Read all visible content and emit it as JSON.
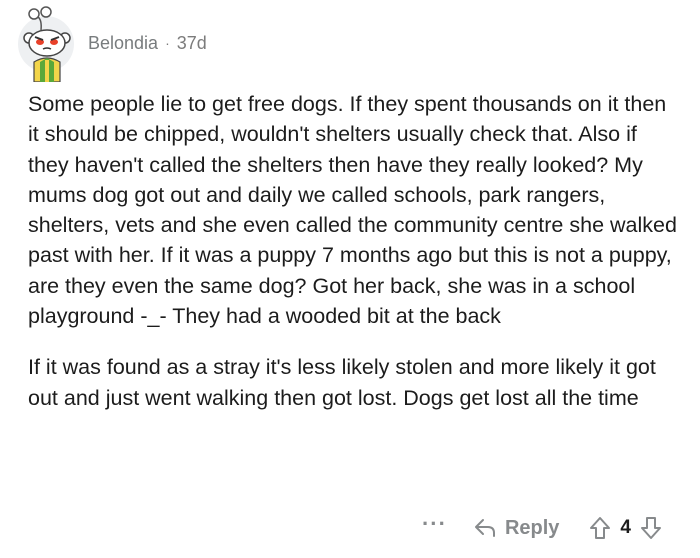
{
  "comment": {
    "author": "Belondia",
    "separator": "·",
    "age": "37d",
    "paragraphs": [
      "Some people lie to get free dogs. If they spent thousands on it then it should be chipped, wouldn't shelters usually check that. Also if they haven't called the shelters then have they really looked? My mums dog got out and daily we called schools, park rangers, shelters, vets and she even called the community centre she walked past with her. If it was a puppy 7 months ago but this is not a puppy, are they even the same dog? Got her back, she was in a school playground -_- They had a wooded bit at the back",
      "If it was found as a stray it's less likely stolen and more likely it got out and just went walking then got lost. Dogs get lost all the time"
    ],
    "actions": {
      "more": "···",
      "reply_label": "Reply",
      "vote_count": "4"
    },
    "icons": {
      "avatar": "reddit-snoo-avatar",
      "reply": "reply-arrow-icon",
      "upvote": "upvote-arrow-icon",
      "downvote": "downvote-arrow-icon",
      "more": "more-dots-icon"
    },
    "colors": {
      "avatar_bg": "#eef0f2",
      "meta_text": "#787c7e",
      "action_text": "#878a8c",
      "body_text": "#1c1c1c"
    }
  }
}
